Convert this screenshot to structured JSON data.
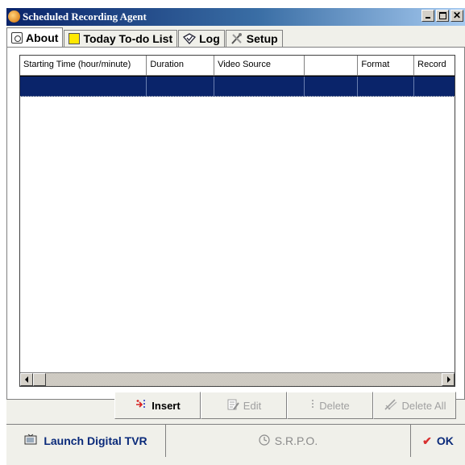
{
  "window": {
    "title": "Scheduled Recording Agent",
    "controls": [
      "_",
      "□",
      "X"
    ]
  },
  "tabs": [
    {
      "label": "About",
      "icon": "alarm-clock-icon",
      "active": true
    },
    {
      "label": "Today To-do List",
      "icon": "sticky-note-icon",
      "active": false
    },
    {
      "label": "Log",
      "icon": "log-check-icon",
      "active": false
    },
    {
      "label": "Setup",
      "icon": "tools-icon",
      "active": false
    }
  ],
  "table": {
    "columns": [
      "Starting Time (hour/minute)",
      "Duration",
      "Video Source",
      "",
      "Format",
      "Record"
    ],
    "rows": [
      {
        "selected": true,
        "cells": [
          "",
          "",
          "",
          "",
          "",
          ""
        ]
      }
    ]
  },
  "actions": {
    "insert": "Insert",
    "edit": "Edit",
    "delete": "Delete",
    "delete_all": "Delete All"
  },
  "footer": {
    "launch": "Launch Digital TVR",
    "srpo": "S.R.P.O.",
    "ok": "OK"
  },
  "colors": {
    "selection": "#0a246a",
    "ok_check": "#d83030",
    "title_gradient_start": "#0a246a"
  }
}
